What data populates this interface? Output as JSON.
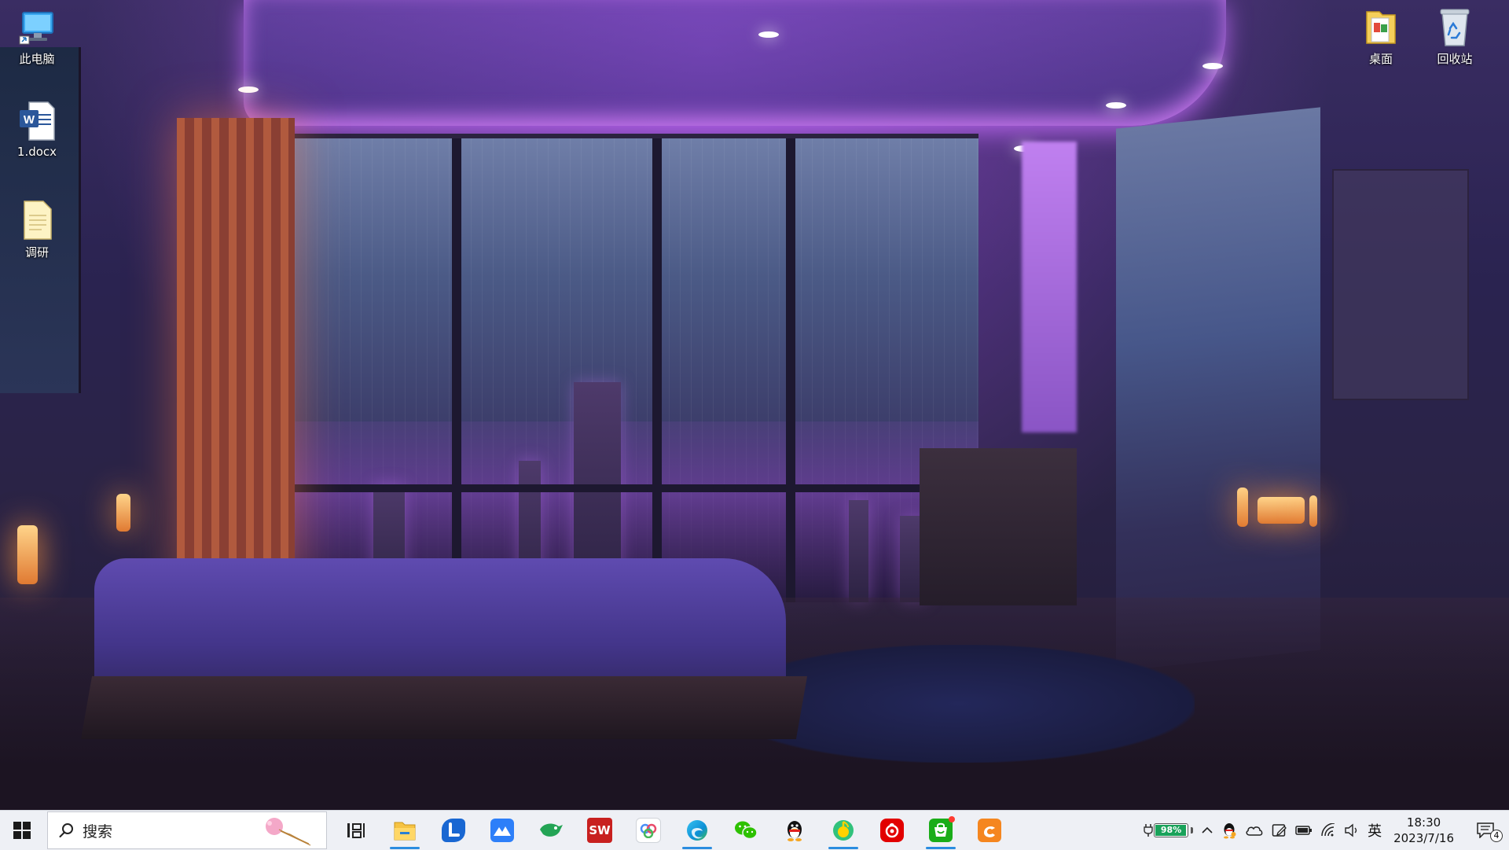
{
  "desktop": {
    "icons_left": [
      {
        "label": "此电脑",
        "icon": "this-pc-icon"
      },
      {
        "label": "1.docx",
        "icon": "word-document-icon"
      },
      {
        "label": "调研",
        "icon": "text-file-icon"
      }
    ],
    "icons_right": [
      {
        "label": "桌面",
        "icon": "desktop-folder-icon"
      },
      {
        "label": "回收站",
        "icon": "recycle-bin-icon"
      }
    ]
  },
  "taskbar": {
    "start_icon": "windows-start-icon",
    "search": {
      "placeholder": "搜索",
      "icon": "search-icon"
    },
    "apps": [
      {
        "name": "task-view",
        "icon": "task-view-icon",
        "active": false
      },
      {
        "name": "file-explorer",
        "icon": "file-explorer-icon",
        "active": true,
        "color": "#f6c343"
      },
      {
        "name": "app-blue-l",
        "icon": "blue-l-app-icon",
        "active": false,
        "color": "#1967d2"
      },
      {
        "name": "app-blue-mountain",
        "icon": "blue-mountain-app-icon",
        "active": false,
        "color": "#2d7ff9"
      },
      {
        "name": "app-green-bird",
        "icon": "green-bird-app-icon",
        "active": false,
        "color": "#23a455"
      },
      {
        "name": "solidworks-2022",
        "icon": "solidworks-app-icon",
        "active": false,
        "color": "#c8201f",
        "text": "SW"
      },
      {
        "name": "baidu-netdisk",
        "icon": "cloud-app-icon",
        "active": false,
        "color": "#4a8ff7"
      },
      {
        "name": "edge",
        "icon": "edge-browser-icon",
        "active": true,
        "color": "#0c8fd6"
      },
      {
        "name": "wechat",
        "icon": "wechat-icon",
        "active": false,
        "color": "#2dc100"
      },
      {
        "name": "qq",
        "icon": "qq-penguin-icon",
        "active": false,
        "color": "#111111"
      },
      {
        "name": "qq-music",
        "icon": "qq-music-icon",
        "active": true,
        "color": "#31c27c"
      },
      {
        "name": "netease-music",
        "icon": "netease-music-icon",
        "active": false,
        "color": "#e20000"
      },
      {
        "name": "green-shopping",
        "icon": "green-shopping-icon",
        "active": true,
        "color": "#1aad19"
      },
      {
        "name": "orange-pdf",
        "icon": "orange-pdf-icon",
        "active": false,
        "color": "#f5861f"
      }
    ]
  },
  "tray": {
    "battery_percent_text": "98%",
    "battery_level": 0.98,
    "icons": [
      {
        "name": "chevron-up-icon"
      },
      {
        "name": "qq-tray-icon"
      },
      {
        "name": "onedrive-icon"
      },
      {
        "name": "pen-tray-icon"
      },
      {
        "name": "battery-tray-icon"
      },
      {
        "name": "wifi-icon"
      },
      {
        "name": "volume-icon"
      }
    ],
    "input_method": "英",
    "clock": {
      "time": "18:30",
      "date": "2023/7/16"
    },
    "notification_count": "4"
  }
}
